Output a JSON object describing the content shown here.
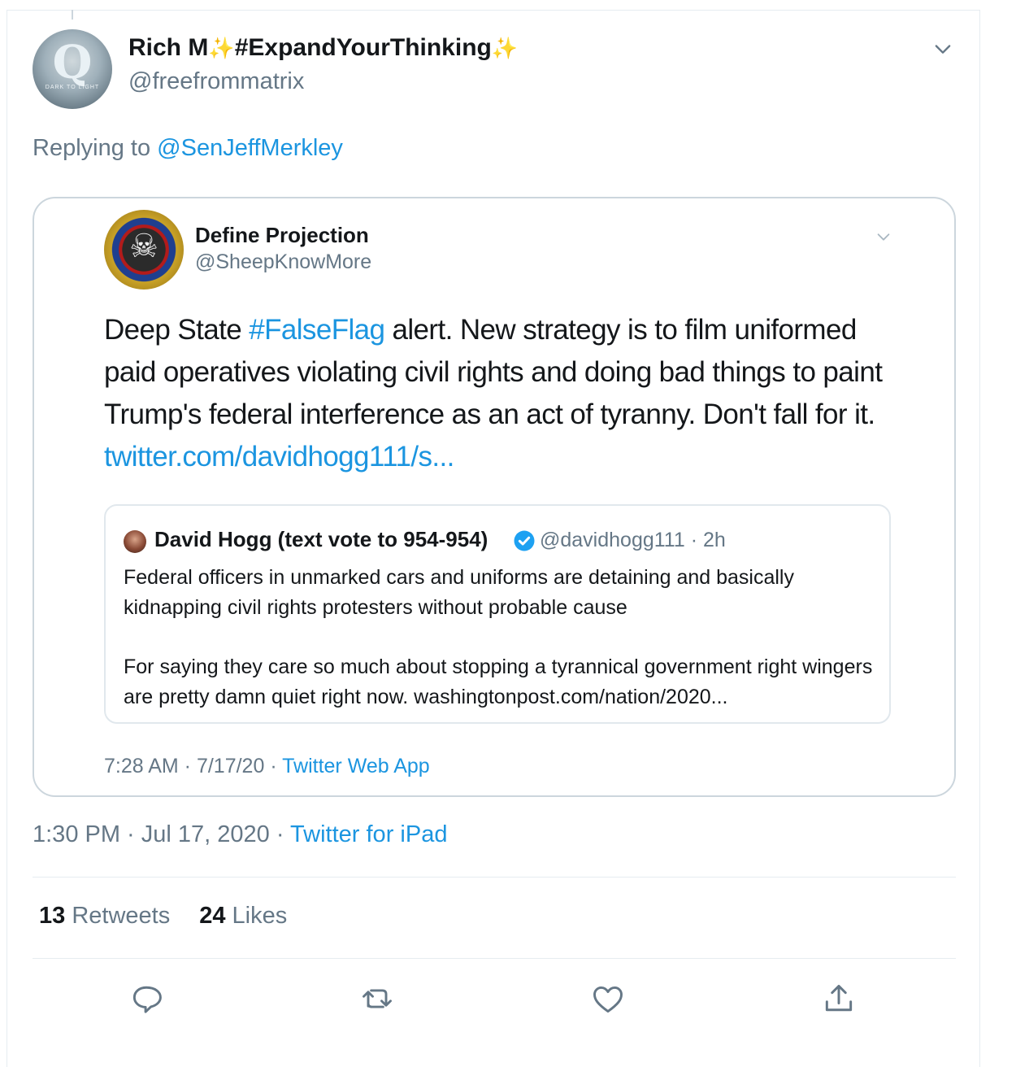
{
  "tweet": {
    "author_name": "Rich M",
    "name_hashtag": "#ExpandYourThinking",
    "author_handle": "@freefrommatrix",
    "avatar_tag": "DARK TO LIGHT",
    "replying_prefix": "Replying to",
    "replying_to": "@SenJeffMerkley",
    "time": "1:30 PM",
    "date": "Jul 17, 2020",
    "source": "Twitter for iPad",
    "retweets_count": "13",
    "retweets_label": "Retweets",
    "likes_count": "24",
    "likes_label": "Likes"
  },
  "quoted": {
    "author_name": "Define Projection",
    "author_handle": "@SheepKnowMore",
    "text_before": "Deep State ",
    "hashtag": "#FalseFlag",
    "text_after": " alert. New strategy is to film uniformed paid operatives violating civil rights and doing bad things to paint Trump's federal interference as an act of tyranny. Don't fall for it.",
    "link": "twitter.com/davidhogg111/s...",
    "time": "7:28 AM",
    "date": "7/17/20",
    "source": "Twitter Web App"
  },
  "inner": {
    "author_name": "David Hogg (text vote to 954-954)",
    "author_handle": "@davidhogg111",
    "age": "2h",
    "para1": "Federal officers in unmarked cars and uniforms are detaining and basically kidnapping civil rights protesters without probable cause",
    "para2": "For saying they care so much about stopping a tyrannical government right wingers are pretty damn quiet right now. washingtonpost.com/nation/2020..."
  },
  "icons": {
    "reply": "reply-icon",
    "retweet": "retweet-icon",
    "like": "heart-icon",
    "share": "share-icon",
    "caret": "chevron-down-icon",
    "verified": "verified-badge-icon",
    "sparkle": "sparkles-icon"
  },
  "colors": {
    "link_blue": "#1b95e0",
    "muted": "#657786",
    "text": "#14171a",
    "border": "#ccd6dd",
    "sparkle": "#f5c242"
  }
}
